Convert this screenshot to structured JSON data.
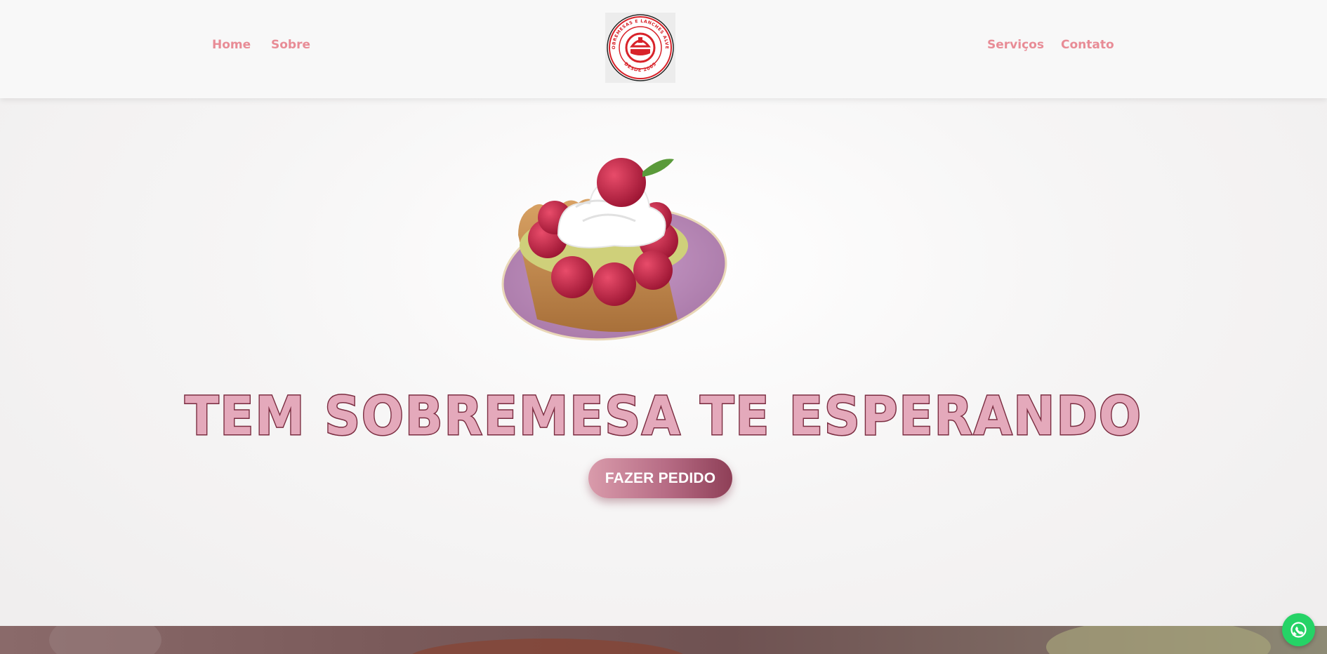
{
  "nav": {
    "left": [
      {
        "label": "Home"
      },
      {
        "label": "Sobre"
      }
    ],
    "right": [
      {
        "label": "Serviços"
      },
      {
        "label": "Contato"
      }
    ]
  },
  "logo": {
    "ring_text": "SOBREMESAS E LANCHES ALVES",
    "bottom_text": "DESDE 2005",
    "color": "#d8232a"
  },
  "hero": {
    "title": "TEM SOBREMESA TE ESPERANDO",
    "cta_label": "FAZER PEDIDO",
    "image": "raspberry-tart-icon"
  },
  "floating": {
    "icon": "whatsapp-icon",
    "color": "#25d366"
  },
  "colors": {
    "nav_link": "#e88c96",
    "title_fill": "#e4a9bb",
    "title_stroke": "#7a2c40",
    "button_start": "#d99bab",
    "button_end": "#8e3f57"
  }
}
